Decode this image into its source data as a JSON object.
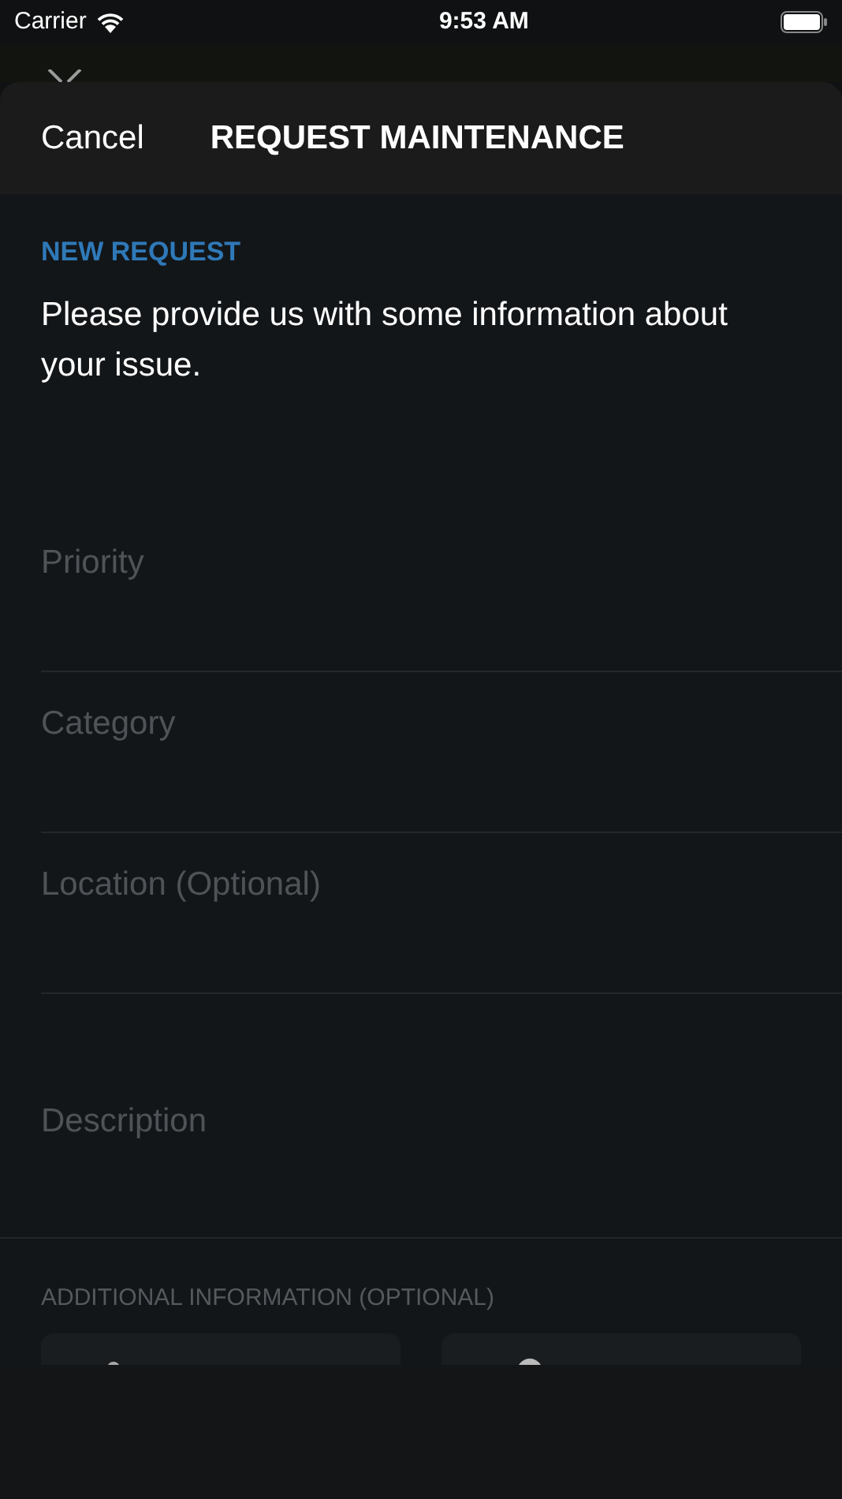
{
  "status_bar": {
    "carrier": "Carrier",
    "time": "9:53 AM"
  },
  "sheet": {
    "cancel": "Cancel",
    "title": "REQUEST MAINTENANCE"
  },
  "section_label": "NEW REQUEST",
  "intro": "Please provide us with some information about your issue.",
  "fields": [
    {
      "placeholder": "Priority",
      "kind": "line"
    },
    {
      "placeholder": "Category",
      "kind": "line"
    },
    {
      "placeholder": "Location (Optional)",
      "kind": "line"
    },
    {
      "placeholder": "Description",
      "kind": "area"
    }
  ],
  "additional": {
    "label": "ADDITIONAL INFORMATION (OPTIONAL)",
    "tiles": [
      {
        "kind": "small"
      },
      {
        "kind": "large"
      }
    ]
  }
}
